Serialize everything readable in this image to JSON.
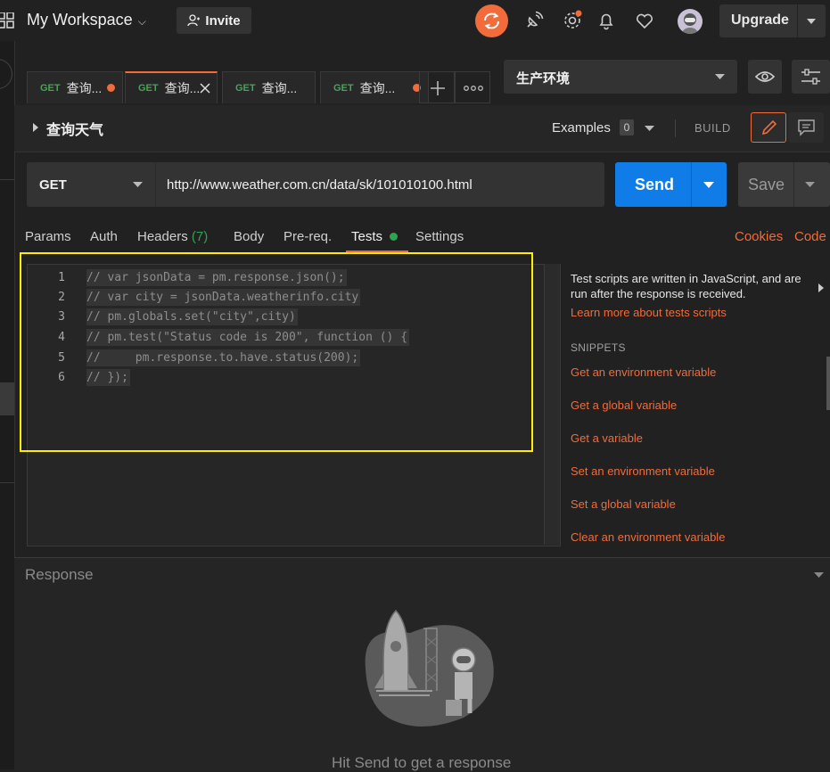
{
  "topbar": {
    "workspace": "My Workspace",
    "invite": "Invite",
    "upgrade": "Upgrade",
    "icons": [
      "grid-icon",
      "sync-icon",
      "satellite-icon",
      "settings-icon",
      "bell-icon",
      "heart-icon",
      "avatar",
      "chevron-down-icon"
    ]
  },
  "tabs": [
    {
      "method": "GET",
      "label": "查询...",
      "unsaved": true
    },
    {
      "method": "GET",
      "label": "查询...",
      "active": true
    },
    {
      "method": "GET",
      "label": "查询..."
    },
    {
      "method": "GET",
      "label": "查询...",
      "unsaved": true
    }
  ],
  "environment": {
    "selected": "生产环境"
  },
  "request": {
    "title": "查询天气",
    "examples_label": "Examples",
    "examples_count": "0",
    "build_label": "BUILD",
    "method": "GET",
    "url": "http://www.weather.com.cn/data/sk/101010100.html",
    "send": "Send",
    "save": "Save"
  },
  "subtabs": {
    "params": "Params",
    "auth": "Auth",
    "headers": "Headers",
    "headers_count": "(7)",
    "body": "Body",
    "prereq": "Pre-req.",
    "tests": "Tests",
    "settings": "Settings",
    "cookies": "Cookies",
    "code": "Code"
  },
  "editor": {
    "lines": [
      {
        "n": "1",
        "code": "// var jsonData = pm.response.json();"
      },
      {
        "n": "2",
        "code": "// var city = jsonData.weatherinfo.city"
      },
      {
        "n": "3",
        "code": "// pm.globals.set(\"city\",city)"
      },
      {
        "n": "4",
        "code": "// pm.test(\"Status code is 200\", function () {"
      },
      {
        "n": "5",
        "code": "//     pm.response.to.have.status(200);"
      },
      {
        "n": "6",
        "code": "// });"
      }
    ]
  },
  "sidepanel": {
    "description": "Test scripts are written in JavaScript, and are run after the response is received.",
    "learn_link": "Learn more about tests scripts",
    "snippets_title": "SNIPPETS",
    "snippets": [
      "Get an environment variable",
      "Get a global variable",
      "Get a variable",
      "Set an environment variable",
      "Set a global variable",
      "Clear an environment variable"
    ]
  },
  "response": {
    "label": "Response",
    "empty_text": "Hit Send to get a response"
  },
  "colors": {
    "accent": "#f26b3a",
    "send": "#0f7ce8",
    "highlight": "#ffee00",
    "get_method": "#4aa15a",
    "tests_dot": "#2ea44f"
  }
}
